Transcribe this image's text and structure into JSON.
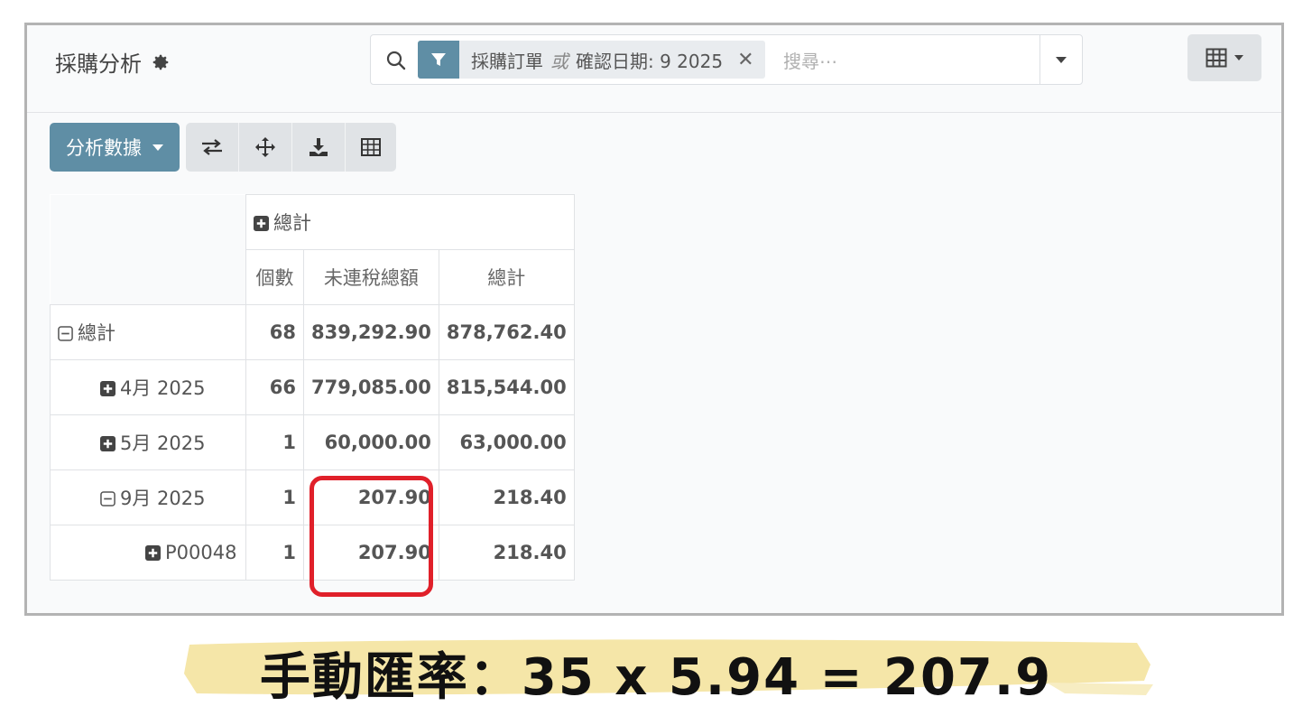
{
  "app": {
    "title": "採購分析"
  },
  "search": {
    "facet_field": "採購訂單",
    "facet_or": "或",
    "facet_value": "確認日期: 9 2025",
    "placeholder": "搜尋⋯"
  },
  "toolbar": {
    "measures_label": "分析數據"
  },
  "pivot": {
    "col_group": "總計",
    "measures": [
      "個數",
      "未連稅總額",
      "總計"
    ],
    "rows": [
      {
        "label": "總計",
        "count": "68",
        "untaxed": "839,292.90",
        "total": "878,762.40"
      },
      {
        "label": "4月 2025",
        "count": "66",
        "untaxed": "779,085.00",
        "total": "815,544.00"
      },
      {
        "label": "5月 2025",
        "count": "1",
        "untaxed": "60,000.00",
        "total": "63,000.00"
      },
      {
        "label": "9月 2025",
        "count": "1",
        "untaxed": "207.90",
        "total": "218.40"
      },
      {
        "label": "P00048",
        "count": "1",
        "untaxed": "207.90",
        "total": "218.40"
      }
    ]
  },
  "caption": "手動匯率：35 x 5.94 = 207.9",
  "colors": {
    "accent": "#5f8ea5",
    "highlight": "#e0202a",
    "brush": "#f5e6a8"
  },
  "icons": [
    "gear-icon",
    "search-icon",
    "filter-icon",
    "close-icon",
    "chevron-down-icon",
    "pivot-view-icon",
    "flip-axis-icon",
    "expand-all-icon",
    "download-icon",
    "table-icon",
    "plus-square-icon",
    "minus-square-icon"
  ]
}
